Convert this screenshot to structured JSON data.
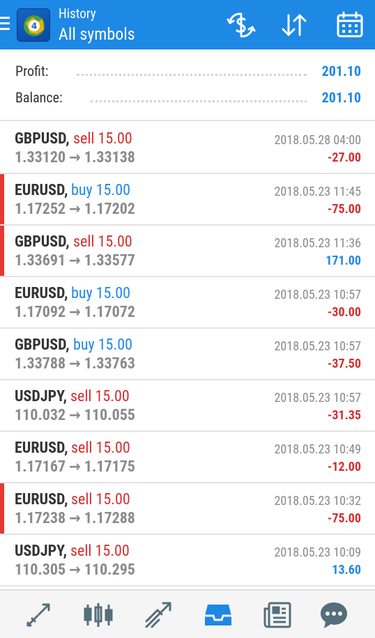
{
  "header": {
    "title_small": "History",
    "title_big": "All symbols",
    "accent_color": "#1e88e5",
    "icons": [
      "menu-icon",
      "currency-exchange-icon",
      "sort-icon",
      "calendar-icon"
    ]
  },
  "summary": {
    "profit_label": "Profit:",
    "profit_value": "201.10",
    "balance_label": "Balance:",
    "balance_value": "201.10"
  },
  "trades": [
    {
      "symbol": "GBPUSD,",
      "direction": "sell 15.00",
      "type": "sell",
      "prices": "1.33120 → 1.33138",
      "time": "2018.05.28 04:00",
      "profit": "-27.00",
      "marked": false
    },
    {
      "symbol": "EURUSD,",
      "direction": "buy 15.00",
      "type": "buy",
      "prices": "1.17252 → 1.17202",
      "time": "2018.05.23 11:45",
      "profit": "-75.00",
      "marked": true
    },
    {
      "symbol": "GBPUSD,",
      "direction": "sell 15.00",
      "type": "sell",
      "prices": "1.33691 → 1.33577",
      "time": "2018.05.23 11:36",
      "profit": "171.00",
      "marked": true
    },
    {
      "symbol": "EURUSD,",
      "direction": "buy 15.00",
      "type": "buy",
      "prices": "1.17092 → 1.17072",
      "time": "2018.05.23 10:57",
      "profit": "-30.00",
      "marked": false
    },
    {
      "symbol": "GBPUSD,",
      "direction": "buy 15.00",
      "type": "buy",
      "prices": "1.33788 → 1.33763",
      "time": "2018.05.23 10:57",
      "profit": "-37.50",
      "marked": false
    },
    {
      "symbol": "USDJPY,",
      "direction": "sell 15.00",
      "type": "sell",
      "prices": "110.032 → 110.055",
      "time": "2018.05.23 10:57",
      "profit": "-31.35",
      "marked": false
    },
    {
      "symbol": "EURUSD,",
      "direction": "sell 15.00",
      "type": "sell",
      "prices": "1.17167 → 1.17175",
      "time": "2018.05.23 10:49",
      "profit": "-12.00",
      "marked": false
    },
    {
      "symbol": "EURUSD,",
      "direction": "sell 15.00",
      "type": "sell",
      "prices": "1.17238 → 1.17288",
      "time": "2018.05.23 10:32",
      "profit": "-75.00",
      "marked": true
    },
    {
      "symbol": "USDJPY,",
      "direction": "sell 15.00",
      "type": "sell",
      "prices": "110.305 → 110.295",
      "time": "2018.05.23 10:09",
      "profit": "13.60",
      "marked": false
    }
  ],
  "bottom_nav": {
    "items": [
      "quotes-icon",
      "chart-icon",
      "trade-icon",
      "history-icon",
      "news-icon",
      "chat-icon"
    ],
    "active": "history-icon",
    "active_color": "#1e88e5",
    "inactive_color": "#546e7a"
  }
}
